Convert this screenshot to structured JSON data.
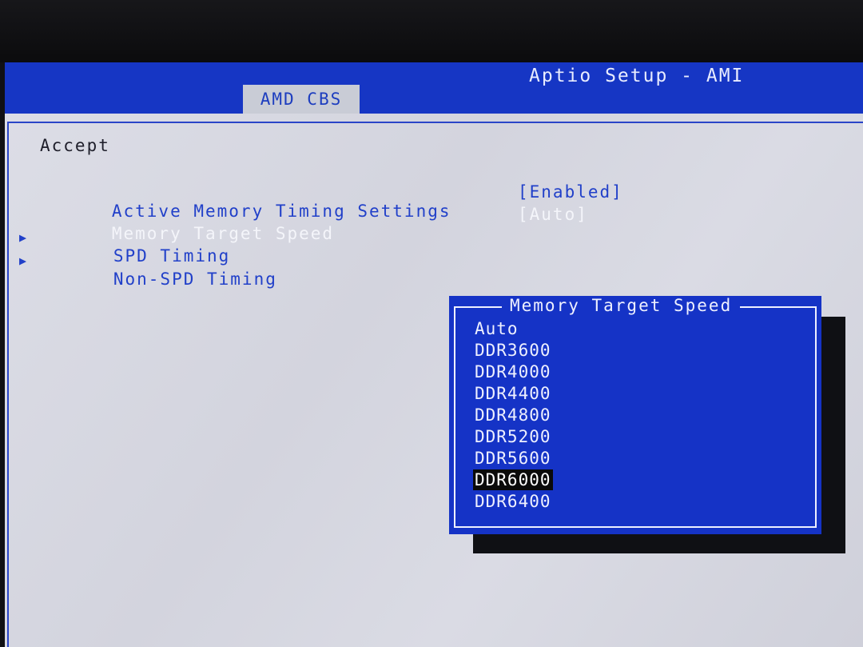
{
  "header": {
    "title": "Aptio Setup - AMI",
    "active_tab": "AMD CBS"
  },
  "main": {
    "accept_label": "Accept",
    "items": [
      {
        "label": "Active Memory Timing Settings",
        "value": "[Enabled]"
      },
      {
        "label": "Memory Target Speed",
        "value": "[Auto]"
      },
      {
        "label": "SPD Timing",
        "submenu": true
      },
      {
        "label": "Non-SPD Timing",
        "submenu": true
      }
    ]
  },
  "popup": {
    "title": "Memory Target Speed",
    "options": [
      "Auto",
      "DDR3600",
      "DDR4000",
      "DDR4400",
      "DDR4800",
      "DDR5200",
      "DDR5600",
      "DDR6000",
      "DDR6400"
    ],
    "selected": "DDR6000"
  },
  "colors": {
    "header_blue": "#1636c4",
    "panel_gray": "#d6d7e0",
    "text_blue": "#2140c9",
    "highlight_white": "#f4f5fa",
    "popup_blue": "#1533c6",
    "selection_black": "#0a0a0a"
  },
  "icons": {
    "submenu": "submenu-arrow-icon"
  }
}
